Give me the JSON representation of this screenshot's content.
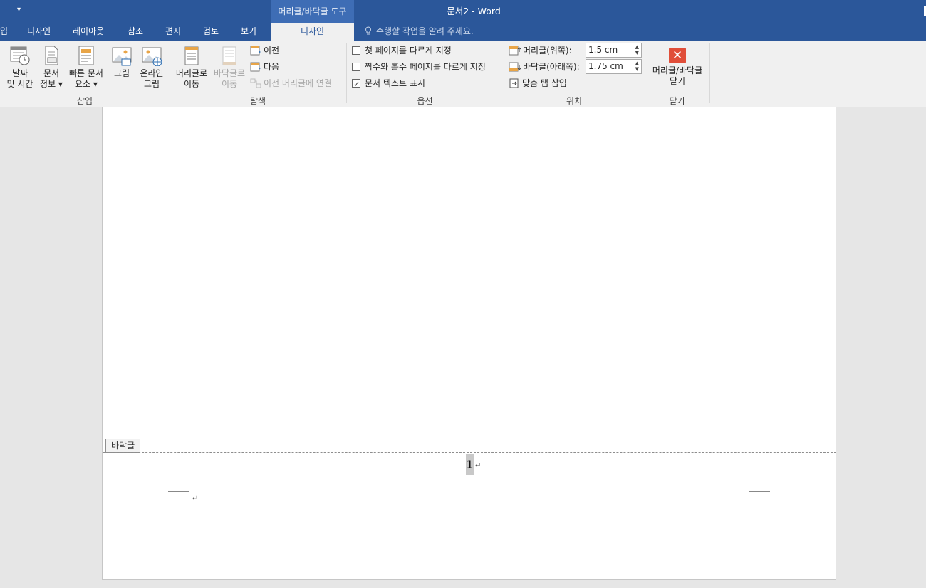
{
  "window": {
    "title": "문서2 - Word",
    "context_tool": "머리글/바닥글 도구",
    "qat_more": "▾"
  },
  "tabs": [
    {
      "label": "입"
    },
    {
      "label": "디자인"
    },
    {
      "label": "레이아웃"
    },
    {
      "label": "참조"
    },
    {
      "label": "편지"
    },
    {
      "label": "검토"
    },
    {
      "label": "보기"
    },
    {
      "label": "디자인",
      "active": true
    }
  ],
  "tell_me": "수행할 작업을 알려 주세요.",
  "ribbon": {
    "insert_group": {
      "label": "삽입",
      "date_time": [
        "날짜",
        "및 시간"
      ],
      "doc_info": [
        "문서",
        "정보 ▾"
      ],
      "quick_parts": [
        "빠른 문서",
        "요소 ▾"
      ],
      "picture": [
        "그림"
      ],
      "online_picture": [
        "온라인",
        "그림"
      ]
    },
    "nav_group": {
      "label": "탐색",
      "goto_header": [
        "머리글로",
        "이동"
      ],
      "goto_footer": [
        "바닥글로",
        "이동"
      ],
      "previous": "이전",
      "next": "다음",
      "link_previous": "이전 머리글에 연결"
    },
    "options_group": {
      "label": "옵션",
      "different_first": {
        "label": "첫 페이지를 다르게 지정",
        "checked": false
      },
      "different_odd_even": {
        "label": "짝수와 홀수 페이지를 다르게 지정",
        "checked": false
      },
      "show_doc_text": {
        "label": "문서 텍스트 표시",
        "checked": true
      }
    },
    "position_group": {
      "label": "위치",
      "header_top_label": "머리글(위쪽):",
      "header_top_value": "1.5 cm",
      "footer_bottom_label": "바닥글(아래쪽):",
      "footer_bottom_value": "1.75 cm",
      "insert_align_tab": "맞춤 탭 삽입"
    },
    "close_group": {
      "label": "닫기",
      "close_button": [
        "머리글/바닥글",
        "닫기"
      ]
    }
  },
  "document": {
    "footer_tag": "바닥글",
    "page_number": "1",
    "paragraph_mark": "↵"
  },
  "colors": {
    "title_bar": "#2b579a",
    "context_tab": "#3e6db5",
    "ribbon": "#f0f0f0",
    "close_icon": "#e04e39"
  }
}
